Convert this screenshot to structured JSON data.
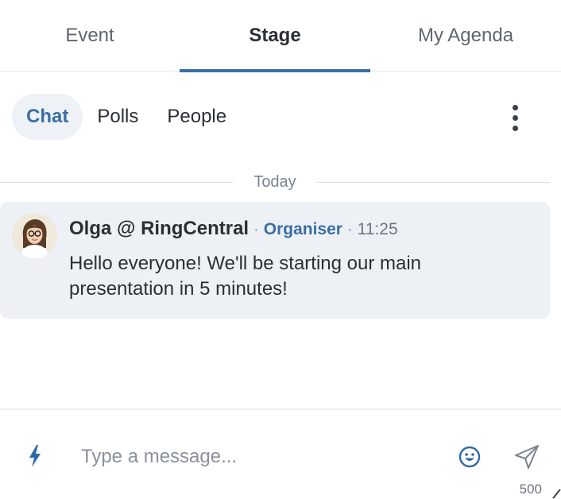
{
  "top_tabs": [
    {
      "label": "Event"
    },
    {
      "label": "Stage"
    },
    {
      "label": "My Agenda"
    }
  ],
  "active_top_tab": "Stage",
  "sub_tabs": [
    {
      "label": "Chat"
    },
    {
      "label": "Polls"
    },
    {
      "label": "People"
    }
  ],
  "active_sub_tab": "Chat",
  "more_menu": {
    "icon": "vertical-ellipsis-icon"
  },
  "chat": {
    "day_separator": "Today",
    "messages": [
      {
        "author": "Olga @ RingCentral",
        "separator": "·",
        "role": "Organiser",
        "time": "11:25",
        "text": "Hello everyone! We'll be starting our main presentation in 5 minutes!",
        "avatar_icon": "user-avatar"
      }
    ]
  },
  "composer": {
    "placeholder": "Type a message...",
    "value": "",
    "char_limit": "500",
    "left_icon": "lightning-bolt-icon",
    "emoji_icon": "smiley-face-icon",
    "send_icon": "send-paper-plane-icon"
  },
  "colors": {
    "accent": "#3a6ea5",
    "message_bg": "#edf1f5",
    "active_chip_bg": "#eef2f6",
    "text": "#2b2f36",
    "muted": "#7b8290"
  }
}
